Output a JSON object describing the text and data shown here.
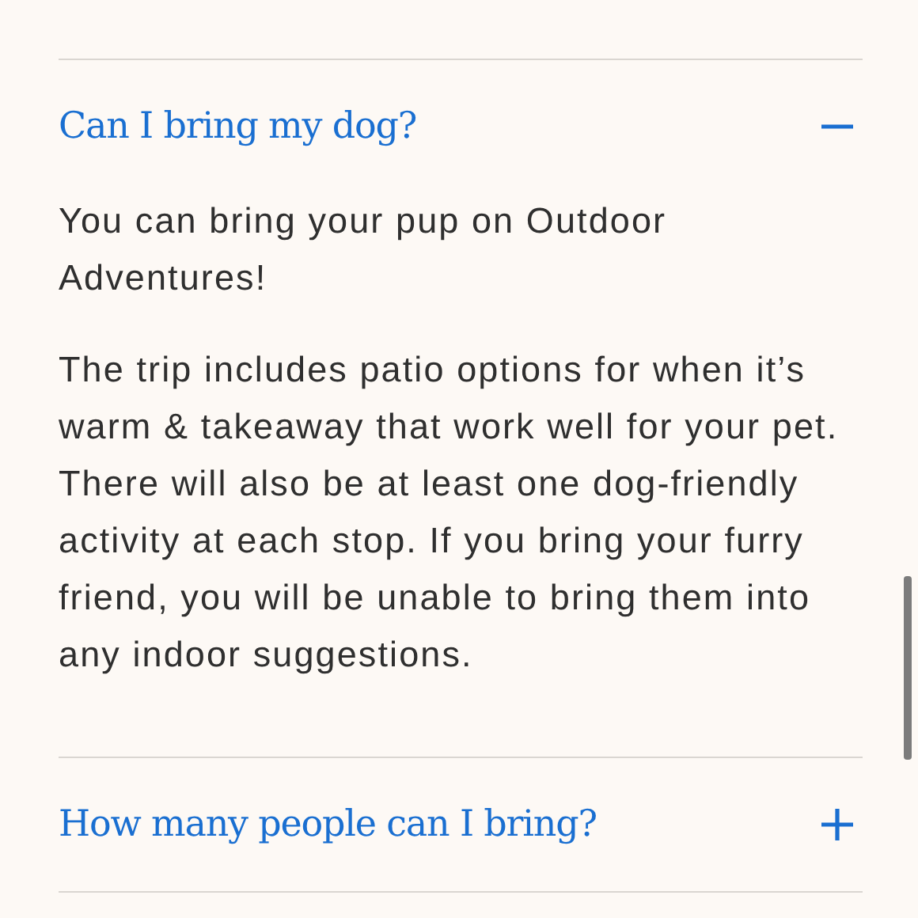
{
  "faq": [
    {
      "question": "Can I bring my dog?",
      "expanded": true,
      "answer": [
        "You can bring your pup on Outdoor Adventures!",
        "The trip includes patio options for when it’s warm & takeaway that work well for your pet. There will also be at least one dog-friendly activity at each stop. If you bring your furry friend, you will be unable to bring them into any indoor suggestions."
      ]
    },
    {
      "question": "How many people can I bring?",
      "expanded": false
    }
  ]
}
